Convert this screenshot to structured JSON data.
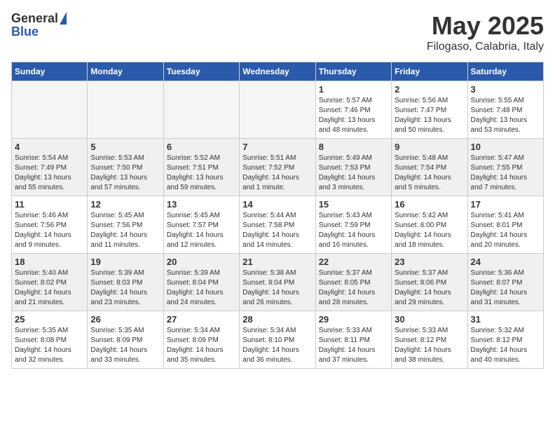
{
  "header": {
    "logo_general": "General",
    "logo_blue": "Blue",
    "month_title": "May 2025",
    "location": "Filogaso, Calabria, Italy"
  },
  "weekdays": [
    "Sunday",
    "Monday",
    "Tuesday",
    "Wednesday",
    "Thursday",
    "Friday",
    "Saturday"
  ],
  "weeks": [
    [
      {
        "day": "",
        "info": ""
      },
      {
        "day": "",
        "info": ""
      },
      {
        "day": "",
        "info": ""
      },
      {
        "day": "",
        "info": ""
      },
      {
        "day": "1",
        "info": "Sunrise: 5:57 AM\nSunset: 7:46 PM\nDaylight: 13 hours\nand 48 minutes."
      },
      {
        "day": "2",
        "info": "Sunrise: 5:56 AM\nSunset: 7:47 PM\nDaylight: 13 hours\nand 50 minutes."
      },
      {
        "day": "3",
        "info": "Sunrise: 5:55 AM\nSunset: 7:48 PM\nDaylight: 13 hours\nand 53 minutes."
      }
    ],
    [
      {
        "day": "4",
        "info": "Sunrise: 5:54 AM\nSunset: 7:49 PM\nDaylight: 13 hours\nand 55 minutes."
      },
      {
        "day": "5",
        "info": "Sunrise: 5:53 AM\nSunset: 7:50 PM\nDaylight: 13 hours\nand 57 minutes."
      },
      {
        "day": "6",
        "info": "Sunrise: 5:52 AM\nSunset: 7:51 PM\nDaylight: 13 hours\nand 59 minutes."
      },
      {
        "day": "7",
        "info": "Sunrise: 5:51 AM\nSunset: 7:52 PM\nDaylight: 14 hours\nand 1 minute."
      },
      {
        "day": "8",
        "info": "Sunrise: 5:49 AM\nSunset: 7:53 PM\nDaylight: 14 hours\nand 3 minutes."
      },
      {
        "day": "9",
        "info": "Sunrise: 5:48 AM\nSunset: 7:54 PM\nDaylight: 14 hours\nand 5 minutes."
      },
      {
        "day": "10",
        "info": "Sunrise: 5:47 AM\nSunset: 7:55 PM\nDaylight: 14 hours\nand 7 minutes."
      }
    ],
    [
      {
        "day": "11",
        "info": "Sunrise: 5:46 AM\nSunset: 7:56 PM\nDaylight: 14 hours\nand 9 minutes."
      },
      {
        "day": "12",
        "info": "Sunrise: 5:45 AM\nSunset: 7:56 PM\nDaylight: 14 hours\nand 11 minutes."
      },
      {
        "day": "13",
        "info": "Sunrise: 5:45 AM\nSunset: 7:57 PM\nDaylight: 14 hours\nand 12 minutes."
      },
      {
        "day": "14",
        "info": "Sunrise: 5:44 AM\nSunset: 7:58 PM\nDaylight: 14 hours\nand 14 minutes."
      },
      {
        "day": "15",
        "info": "Sunrise: 5:43 AM\nSunset: 7:59 PM\nDaylight: 14 hours\nand 16 minutes."
      },
      {
        "day": "16",
        "info": "Sunrise: 5:42 AM\nSunset: 8:00 PM\nDaylight: 14 hours\nand 18 minutes."
      },
      {
        "day": "17",
        "info": "Sunrise: 5:41 AM\nSunset: 8:01 PM\nDaylight: 14 hours\nand 20 minutes."
      }
    ],
    [
      {
        "day": "18",
        "info": "Sunrise: 5:40 AM\nSunset: 8:02 PM\nDaylight: 14 hours\nand 21 minutes."
      },
      {
        "day": "19",
        "info": "Sunrise: 5:39 AM\nSunset: 8:03 PM\nDaylight: 14 hours\nand 23 minutes."
      },
      {
        "day": "20",
        "info": "Sunrise: 5:39 AM\nSunset: 8:04 PM\nDaylight: 14 hours\nand 24 minutes."
      },
      {
        "day": "21",
        "info": "Sunrise: 5:38 AM\nSunset: 8:04 PM\nDaylight: 14 hours\nand 26 minutes."
      },
      {
        "day": "22",
        "info": "Sunrise: 5:37 AM\nSunset: 8:05 PM\nDaylight: 14 hours\nand 28 minutes."
      },
      {
        "day": "23",
        "info": "Sunrise: 5:37 AM\nSunset: 8:06 PM\nDaylight: 14 hours\nand 29 minutes."
      },
      {
        "day": "24",
        "info": "Sunrise: 5:36 AM\nSunset: 8:07 PM\nDaylight: 14 hours\nand 31 minutes."
      }
    ],
    [
      {
        "day": "25",
        "info": "Sunrise: 5:35 AM\nSunset: 8:08 PM\nDaylight: 14 hours\nand 32 minutes."
      },
      {
        "day": "26",
        "info": "Sunrise: 5:35 AM\nSunset: 8:09 PM\nDaylight: 14 hours\nand 33 minutes."
      },
      {
        "day": "27",
        "info": "Sunrise: 5:34 AM\nSunset: 8:09 PM\nDaylight: 14 hours\nand 35 minutes."
      },
      {
        "day": "28",
        "info": "Sunrise: 5:34 AM\nSunset: 8:10 PM\nDaylight: 14 hours\nand 36 minutes."
      },
      {
        "day": "29",
        "info": "Sunrise: 5:33 AM\nSunset: 8:11 PM\nDaylight: 14 hours\nand 37 minutes."
      },
      {
        "day": "30",
        "info": "Sunrise: 5:33 AM\nSunset: 8:12 PM\nDaylight: 14 hours\nand 38 minutes."
      },
      {
        "day": "31",
        "info": "Sunrise: 5:32 AM\nSunset: 8:12 PM\nDaylight: 14 hours\nand 40 minutes."
      }
    ]
  ]
}
